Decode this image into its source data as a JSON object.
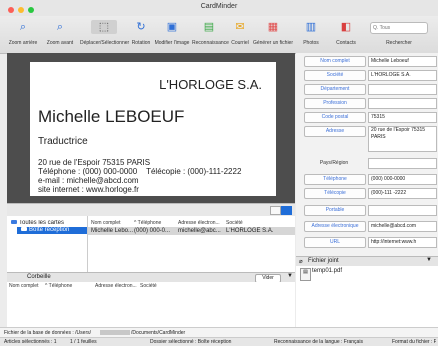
{
  "window": {
    "title": "CardMinder"
  },
  "toolbar": {
    "items": [
      {
        "label": "Zoom arrière",
        "icon": "zoom-out-icon",
        "glyph": "⌕"
      },
      {
        "label": "Zoom avant",
        "icon": "zoom-in-icon",
        "glyph": "⌕"
      },
      {
        "label": "Déplacer/Sélectionner",
        "icon": "move-select-icon",
        "glyph": "⬚"
      },
      {
        "label": "Rotation",
        "icon": "rotate-icon",
        "glyph": "↻"
      },
      {
        "label": "Modifier l'image",
        "icon": "edit-image-icon",
        "glyph": "▣"
      },
      {
        "label": "Reconnaissance",
        "icon": "recognition-icon",
        "glyph": "▤"
      },
      {
        "label": "Courriel",
        "icon": "mail-icon",
        "glyph": "✉"
      },
      {
        "label": "Générer un fichier",
        "icon": "export-file-icon",
        "glyph": "▦"
      },
      {
        "label": "Photos",
        "icon": "photos-icon",
        "glyph": "▥"
      },
      {
        "label": "Contacts",
        "icon": "contacts-icon",
        "glyph": "◧"
      },
      {
        "label": "Rechercher",
        "icon": "search-icon",
        "glyph": "⌕"
      }
    ],
    "search_placeholder": "Q. Tous"
  },
  "card": {
    "company": "L'HORLOGE S.A.",
    "name": "Michelle LEBOEUF",
    "job": "Traductrice",
    "address": "20 rue de l'Espoir 75315 PARIS",
    "phone": "Téléphone : (000) 000-0000",
    "fax": "Télécopie : (000)-111-2222",
    "email": "e-mail : michelle@abcd.com",
    "site": "site internet : www.horloge.fr"
  },
  "tree": {
    "root": "Toutes les cartes",
    "inbox": "Boîte réception"
  },
  "list": {
    "columns": [
      "Nom complet",
      "^ Téléphone",
      "Adresse électron...",
      "Société"
    ],
    "row": {
      "name": "Michelle Lebo...",
      "phone": "(000) 000-0...",
      "email": "michelle@abc...",
      "company": "L'HORLOGE S.A."
    }
  },
  "trash": {
    "title": "Corbeille",
    "empty_label": "Vider",
    "columns": [
      "Nom complet",
      "^ Téléphone",
      "Adresse électron...",
      "Société"
    ]
  },
  "fields": [
    {
      "label": "Nom complet",
      "value": "Michelle Leboeuf"
    },
    {
      "label": "Société",
      "value": "L'HORLOGE S.A."
    },
    {
      "label": "Département",
      "value": ""
    },
    {
      "label": "Profession",
      "value": ""
    },
    {
      "label": "Code postal",
      "value": "75315"
    },
    {
      "label": "Adresse",
      "value": "20 rue de l'Espoir 75315 PARIS"
    },
    {
      "label": "Pays/Région",
      "value": ""
    },
    {
      "label": "Téléphone",
      "value": "(000) 000-0000"
    },
    {
      "label": "Télécopie",
      "value": "(000)-111 -2222"
    },
    {
      "label": "Portable",
      "value": ""
    },
    {
      "label": "Adresse électronique",
      "value": "michelle@abcd.com"
    },
    {
      "label": "URL",
      "value": "http://internet:www.h"
    }
  ],
  "attachment": {
    "header": "Fichier joint",
    "file": "temp01.pdf"
  },
  "status": {
    "db_path": "Fichier de la base de données : /Users/",
    "db_path_end": "/Documents/CardMinder",
    "selected": "Articles sélectionnés : 1",
    "sheets": "1 / 1 feuilles",
    "folder": "Dossier sélectionné : Boîte réception",
    "language": "Reconnaissance de la langue : Français",
    "format": "Format du fichier : P"
  },
  "colors": {
    "accent": "#1f6dd8",
    "close": "#fc5f57",
    "minimize": "#fdbc2e",
    "maximize": "#29c840"
  }
}
